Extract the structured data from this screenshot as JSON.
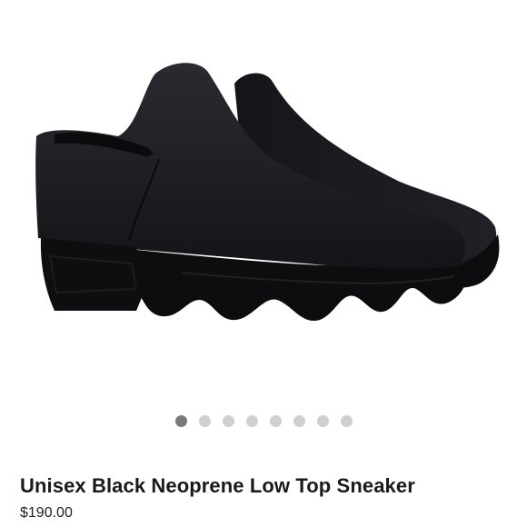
{
  "product": {
    "title": "Unisex Black Neoprene Low Top Sneaker",
    "price": "$190.00",
    "image_subject": "black neoprene slip-on sneakers",
    "colors": {
      "shoe": "#1c1c22",
      "sole": "#0d0d0f",
      "dot_active": "#7a7a7a",
      "dot_inactive": "#cfcfcf"
    }
  },
  "carousel": {
    "count": 8,
    "active_index": 0
  }
}
